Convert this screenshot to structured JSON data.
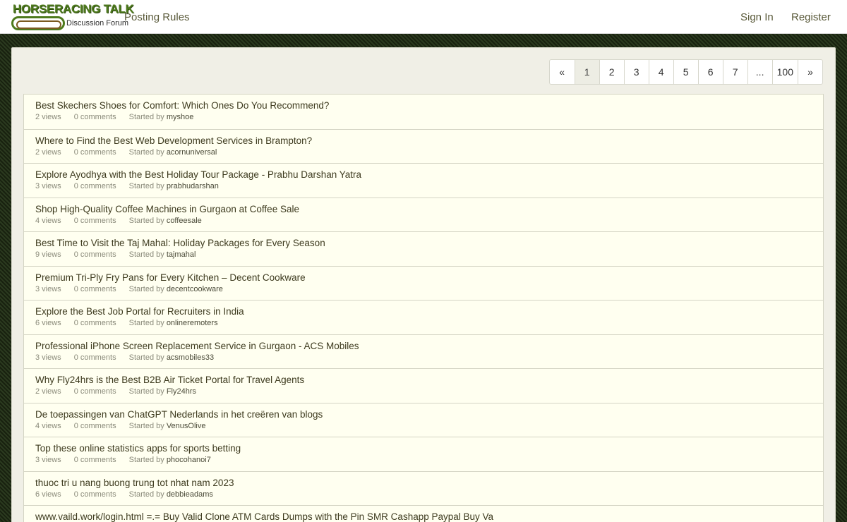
{
  "header": {
    "logo_title": "HORSERACING TALK",
    "logo_subtitle": "Discussion Forum",
    "posting_rules": "Posting Rules",
    "sign_in": "Sign In",
    "register": "Register"
  },
  "pagination": [
    "«",
    "1",
    "2",
    "3",
    "4",
    "5",
    "6",
    "7",
    "...",
    "100",
    "»"
  ],
  "pagination_active": "1",
  "topics": [
    {
      "title": "Best Skechers Shoes for Comfort: Which Ones Do You Recommend?",
      "views": "2 views",
      "comments": "0 comments",
      "started": "Started by",
      "author": "myshoe"
    },
    {
      "title": "Where to Find the Best Web Development Services in Brampton?",
      "views": "2 views",
      "comments": "0 comments",
      "started": "Started by",
      "author": "acornuniversal"
    },
    {
      "title": "Explore Ayodhya with the Best Holiday Tour Package - Prabhu Darshan Yatra",
      "views": "3 views",
      "comments": "0 comments",
      "started": "Started by",
      "author": "prabhudarshan"
    },
    {
      "title": "Shop High-Quality Coffee Machines in Gurgaon at Coffee Sale",
      "views": "4 views",
      "comments": "0 comments",
      "started": "Started by",
      "author": "coffeesale"
    },
    {
      "title": "Best Time to Visit the Taj Mahal: Holiday Packages for Every Season",
      "views": "9 views",
      "comments": "0 comments",
      "started": "Started by",
      "author": "tajmahal"
    },
    {
      "title": "Premium Tri-Ply Fry Pans for Every Kitchen – Decent Cookware",
      "views": "3 views",
      "comments": "0 comments",
      "started": "Started by",
      "author": "decentcookware"
    },
    {
      "title": "Explore the Best Job Portal for Recruiters in India",
      "views": "6 views",
      "comments": "0 comments",
      "started": "Started by",
      "author": "onlineremoters"
    },
    {
      "title": "Professional iPhone Screen Replacement Service in Gurgaon - ACS Mobiles",
      "views": "3 views",
      "comments": "0 comments",
      "started": "Started by",
      "author": "acsmobiles33"
    },
    {
      "title": "Why Fly24hrs is the Best B2B Air Ticket Portal for Travel Agents",
      "views": "2 views",
      "comments": "0 comments",
      "started": "Started by",
      "author": "Fly24hrs"
    },
    {
      "title": "De toepassingen van ChatGPT Nederlands in het creëren van blogs",
      "views": "4 views",
      "comments": "0 comments",
      "started": "Started by",
      "author": "VenusOlive"
    },
    {
      "title": "Top these online statistics apps for sports betting",
      "views": "3 views",
      "comments": "0 comments",
      "started": "Started by",
      "author": "phocohanoi7"
    },
    {
      "title": "thuoc tri u nang buong trung tot nhat nam 2023",
      "views": "6 views",
      "comments": "0 comments",
      "started": "Started by",
      "author": "debbieadams"
    },
    {
      "title": "www.vaild.work/login.html =.= Buy Valid Clone ATM Cards Dumps with the Pin SMR Cashapp Paypal Buy Va",
      "views": "",
      "comments": "",
      "started": "",
      "author": ""
    }
  ]
}
